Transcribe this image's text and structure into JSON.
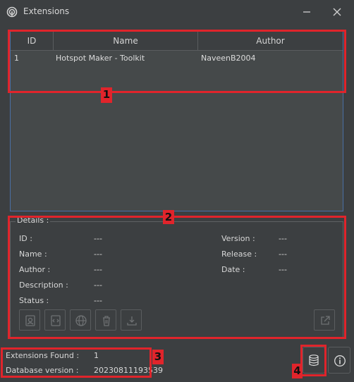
{
  "window": {
    "title": "Extensions"
  },
  "table": {
    "columns": [
      "ID",
      "Name",
      "Author"
    ],
    "rows": [
      {
        "id": "1",
        "name": "Hotspot Maker - Toolkit",
        "author": "NaveenB2004"
      }
    ]
  },
  "details": {
    "legend": "Details :",
    "id_label": "ID :",
    "id_value": "---",
    "name_label": "Name :",
    "name_value": "---",
    "author_label": "Author :",
    "author_value": "---",
    "description_label": "Description :",
    "description_value": "---",
    "status_label": "Status :",
    "status_value": "---",
    "version_label": "Version :",
    "version_value": "---",
    "release_label": "Release :",
    "release_value": "---",
    "date_label": "Date :",
    "date_value": "---"
  },
  "footer": {
    "found_label": "Extensions Found :",
    "found_value": "1",
    "db_label": "Database version :",
    "db_value": "20230811193539"
  },
  "annotations": {
    "c1": "1",
    "c2": "2",
    "c3": "3",
    "c4": "4"
  },
  "colors": {
    "background": "#3c3f41",
    "highlight": "#e0242b",
    "table_border": "#4a6fa5"
  },
  "icons": [
    "app-icon",
    "minimize-icon",
    "close-icon",
    "install-icon",
    "code-icon",
    "web-icon",
    "delete-icon",
    "download-icon",
    "open-external-icon",
    "database-icon",
    "info-icon"
  ]
}
